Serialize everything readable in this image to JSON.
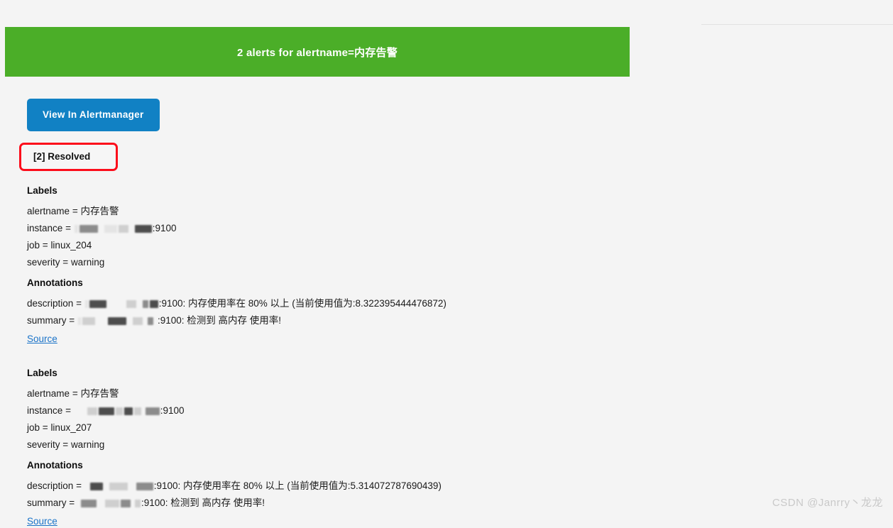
{
  "page": {
    "background_color": "#f4f4f4",
    "watermark": "CSDN @Janrry丶龙龙"
  },
  "banner": {
    "title": "2 alerts for alertname=内存告警",
    "background_color": "#4bae28",
    "text_color": "#ffffff"
  },
  "actions": {
    "view_in_alertmanager_label": "View In Alertmanager",
    "view_in_alertmanager_color": "#1181c4",
    "status_label": "[2] Resolved",
    "status_border_color": "#fc0d1b"
  },
  "sections": {
    "labels_heading": "Labels",
    "annotations_heading": "Annotations",
    "source_link_label": "Source"
  },
  "alerts": [
    {
      "labels": [
        {
          "key": "alertname",
          "value": "内存告警",
          "redacted": false
        },
        {
          "key": "instance",
          "value": ":9100",
          "redacted": true
        },
        {
          "key": "job",
          "value": "linux_204",
          "redacted": false
        },
        {
          "key": "severity",
          "value": "warning",
          "redacted": false
        }
      ],
      "annotations": [
        {
          "key": "description",
          "value": ":9100: 内存使用率在 80% 以上 (当前使用值为:8.322395444476872)",
          "redacted": true,
          "current_value": "8.322395444476872",
          "threshold": "80%"
        },
        {
          "key": "summary",
          "value": ":9100: 检测到 高内存 使用率!",
          "redacted": true
        }
      ],
      "source_label": "Source"
    },
    {
      "labels": [
        {
          "key": "alertname",
          "value": "内存告警",
          "redacted": false
        },
        {
          "key": "instance",
          "value": ":9100",
          "redacted": true
        },
        {
          "key": "job",
          "value": "linux_207",
          "redacted": false
        },
        {
          "key": "severity",
          "value": "warning",
          "redacted": false
        }
      ],
      "annotations": [
        {
          "key": "description",
          "value": ":9100: 内存使用率在 80% 以上 (当前使用值为:5.314072787690439)",
          "redacted": true,
          "current_value": "5.314072787690439",
          "threshold": "80%"
        },
        {
          "key": "summary",
          "value": ":9100: 检测到 高内存 使用率!",
          "redacted": true
        }
      ],
      "source_label": "Source"
    }
  ]
}
